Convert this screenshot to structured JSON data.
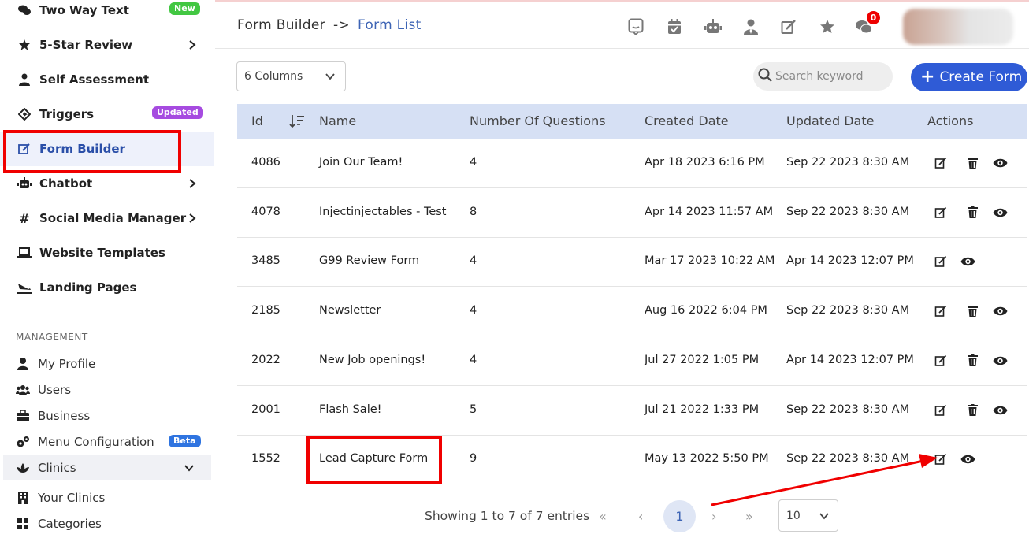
{
  "sidebar": {
    "items": [
      {
        "label": "Two Way Text",
        "icon": "chat-bubbles-icon",
        "badge": "New",
        "badge_color": "#42c742"
      },
      {
        "label": "5-Star Review",
        "icon": "star-gear-icon"
      },
      {
        "label": "Self Assessment",
        "icon": "user-tie-icon"
      },
      {
        "label": "Triggers",
        "icon": "diamond-arrow-icon",
        "badge": "Updated",
        "badge_color": "#a64be0"
      },
      {
        "label": "Form Builder",
        "icon": "edit-icon"
      },
      {
        "label": "Chatbot",
        "icon": "robot-icon"
      },
      {
        "label": "Social Media Manager",
        "icon": "hashtag-icon"
      },
      {
        "label": "Website Templates",
        "icon": "laptop-icon"
      },
      {
        "label": "Landing Pages",
        "icon": "plane-landing-icon"
      }
    ],
    "management_title": "MANAGEMENT",
    "management": [
      {
        "label": "My Profile",
        "icon": "user-icon"
      },
      {
        "label": "Users",
        "icon": "users-icon"
      },
      {
        "label": "Business",
        "icon": "briefcase-icon"
      },
      {
        "label": "Menu Configuration",
        "icon": "cogs-icon",
        "badge": "Beta",
        "badge_color": "#2f74e0"
      },
      {
        "label": "Clinics",
        "icon": "lotus-icon"
      },
      {
        "label": "Your Clinics",
        "icon": "building-icon"
      },
      {
        "label": "Categories",
        "icon": "grid-icon"
      }
    ]
  },
  "header": {
    "crumb_parent": "Form Builder",
    "crumb_sep": "->",
    "crumb_current": "Form List",
    "notification_count": "0"
  },
  "toolbar": {
    "columns_select": "6 Columns",
    "search_placeholder": "Search keyword",
    "create_label": "Create Form"
  },
  "table": {
    "headers": [
      "Id",
      "Name",
      "Number Of Questions",
      "Created Date",
      "Updated Date",
      "Actions"
    ],
    "rows": [
      {
        "id": "4086",
        "name": "Join Our Team!",
        "questions": "4",
        "created": "Apr 18 2023 6:16 PM",
        "updated": "Sep 22 2023 8:30 AM",
        "delete": true
      },
      {
        "id": "4078",
        "name": "Injectinjectables - Test",
        "questions": "8",
        "created": "Apr 14 2023 11:57 AM",
        "updated": "Sep 22 2023 8:30 AM",
        "delete": true
      },
      {
        "id": "3485",
        "name": "G99 Review Form",
        "questions": "4",
        "created": "Mar 17 2023 10:22 AM",
        "updated": "Apr 14 2023 12:07 PM",
        "delete": false
      },
      {
        "id": "2185",
        "name": "Newsletter",
        "questions": "4",
        "created": "Aug 16 2022 6:04 PM",
        "updated": "Sep 22 2023 8:30 AM",
        "delete": true
      },
      {
        "id": "2022",
        "name": "New Job openings!",
        "questions": "4",
        "created": "Jul 27 2022 1:05 PM",
        "updated": "Apr 14 2023 12:07 PM",
        "delete": true
      },
      {
        "id": "2001",
        "name": "Flash Sale!",
        "questions": "5",
        "created": "Jul 21 2022 1:33 PM",
        "updated": "Sep 22 2023 8:30 AM",
        "delete": true
      },
      {
        "id": "1552",
        "name": "Lead Capture Form",
        "questions": "9",
        "created": "May 13 2022 5:50 PM",
        "updated": "Sep 22 2023 8:30 AM",
        "delete": false
      }
    ]
  },
  "pagination": {
    "showing": "Showing 1 to 7 of 7 entries",
    "current_page": "1",
    "page_size": "10"
  },
  "colors": {
    "accent": "#2f5bd6",
    "header_bg": "#d6e0f4",
    "highlight": "#f00000"
  }
}
